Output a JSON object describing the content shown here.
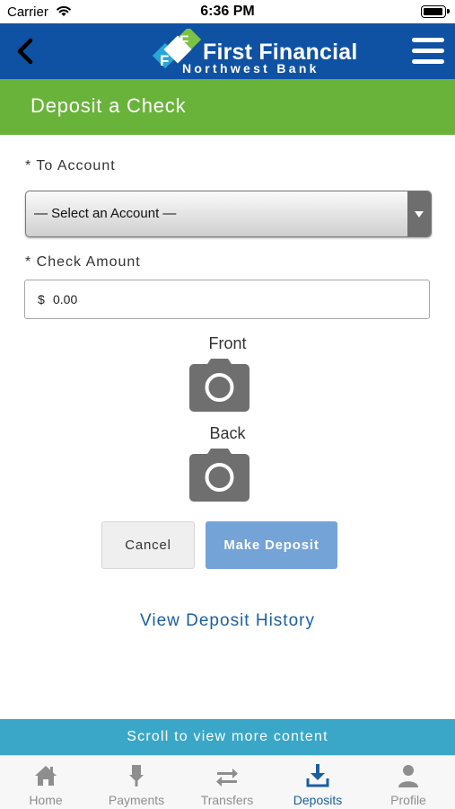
{
  "status_bar": {
    "carrier": "Carrier",
    "time": "6:36 PM"
  },
  "header": {
    "brand_title": "First Financial",
    "brand_subtitle": "Northwest Bank",
    "brand_mark": "FF"
  },
  "page": {
    "title": "Deposit a Check"
  },
  "form": {
    "account_label": "* To Account",
    "account_value": "— Select an Account —",
    "amount_label": "* Check Amount",
    "currency_symbol": "$",
    "amount_value": "0.00",
    "front_label": "Front",
    "back_label": "Back"
  },
  "actions": {
    "cancel_label": "Cancel",
    "deposit_label": "Make Deposit",
    "history_link": "View Deposit History"
  },
  "banner": {
    "text": "Scroll to view more content"
  },
  "tabs": [
    {
      "label": "Home",
      "icon": "home-icon",
      "active": false
    },
    {
      "label": "Payments",
      "icon": "payments-icon",
      "active": false
    },
    {
      "label": "Transfers",
      "icon": "transfers-icon",
      "active": false
    },
    {
      "label": "Deposits",
      "icon": "deposits-icon",
      "active": true
    },
    {
      "label": "Profile",
      "icon": "profile-icon",
      "active": false
    }
  ],
  "colors": {
    "header": "#0f52a3",
    "title_bar": "#69b33a",
    "deposit_button": "#74a3d8",
    "link": "#1a5fa0",
    "banner": "#3aa7c9"
  }
}
